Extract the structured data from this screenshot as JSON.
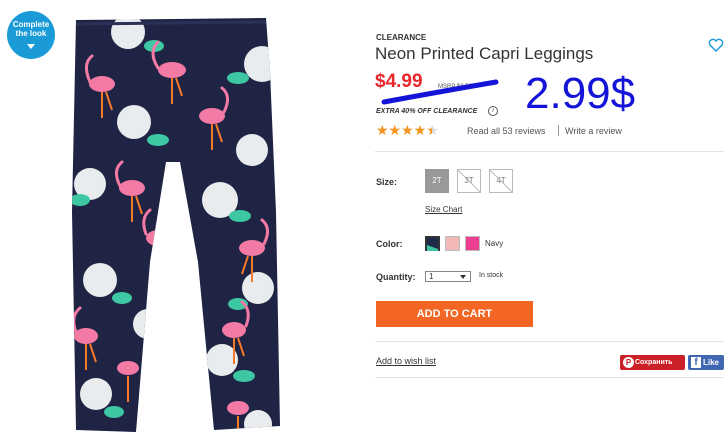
{
  "badge": {
    "label": "Complete the look"
  },
  "product": {
    "clearance_label": "CLEARANCE",
    "title": "Neon Printed Capri Leggings",
    "price": "$4.99",
    "msrp": "MSRP $8.50",
    "handwritten_price": "2.99$",
    "extra_offer": "EXTRA 40% OFF CLEARANCE",
    "info_glyph": "i"
  },
  "reviews": {
    "stars": "★★★★★",
    "rating": 4.5,
    "read_all": "Read all 53 reviews",
    "write": "Write a review"
  },
  "size": {
    "label": "Size:",
    "options": [
      "2T",
      "3T",
      "4T"
    ],
    "selected": "2T",
    "chart_link": "Size Chart"
  },
  "color": {
    "label": "Color:",
    "swatches": [
      "#1e2a4a",
      "#f2b8b8",
      "#ec3d8e"
    ],
    "selected_name": "Navy"
  },
  "quantity": {
    "label": "Quantity:",
    "value": "1",
    "stock": "In stock"
  },
  "actions": {
    "add_to_cart": "ADD TO CART",
    "wishlist": "Add to wish list",
    "pin": "Сохранить",
    "pin_glyph": "P",
    "fb": "Like",
    "fb_glyph": "f"
  },
  "colors": {
    "accent_blue": "#1a9bd7",
    "price_red": "#e8262c",
    "cta_orange": "#f26522",
    "star_orange": "#f7941d",
    "pinterest_red": "#cb2027",
    "facebook_blue": "#4267b2",
    "handwritten_blue": "#1414d8"
  }
}
